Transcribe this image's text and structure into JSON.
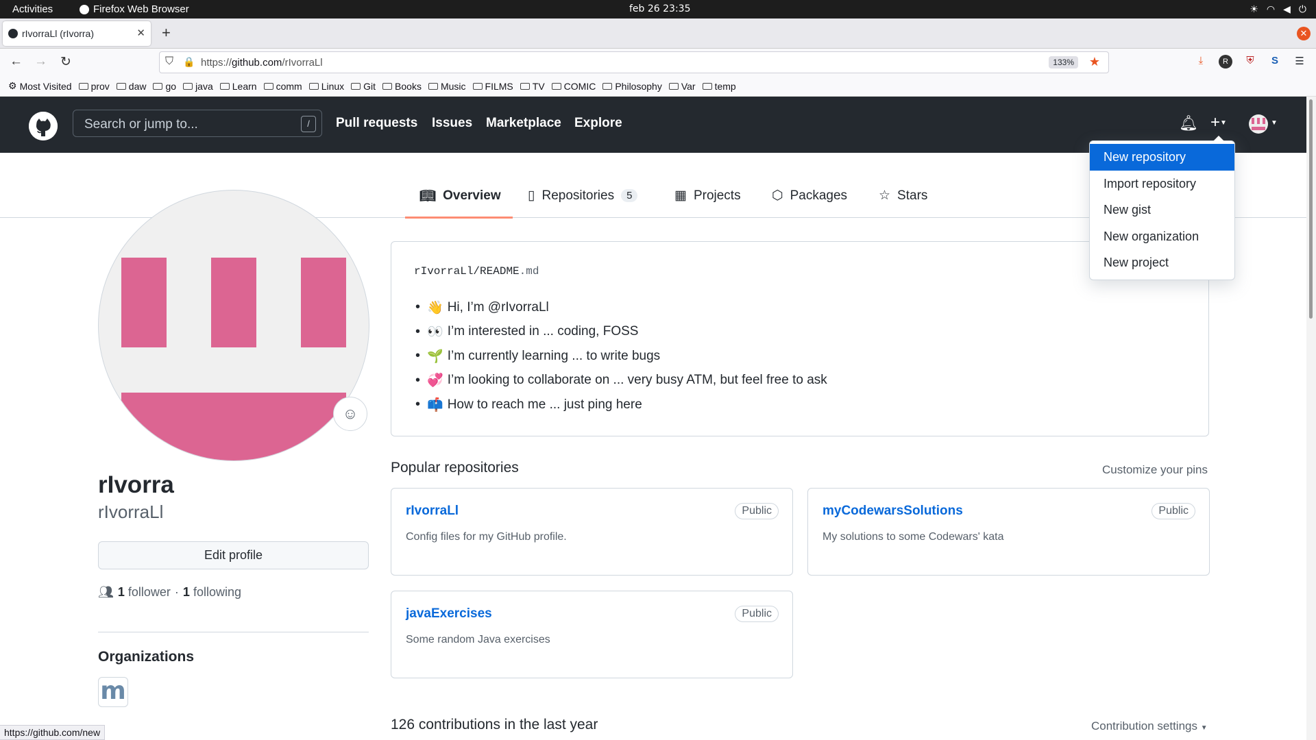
{
  "system": {
    "activities": "Activities",
    "app_name": "Firefox Web Browser",
    "clock": "feb 26  23:35"
  },
  "browser": {
    "tab_title": "rIvorraLl (rIvorra)",
    "url_prefix": "https://",
    "url_domain": "github.com",
    "url_path": "/rIvorraLl",
    "zoom": "133%",
    "status_url": "https://github.com/new"
  },
  "bookmarks": [
    "Most Visited",
    "prov",
    "daw",
    "go",
    "java",
    "Learn",
    "comm",
    "Linux",
    "Git",
    "Books",
    "Music",
    "FILMS",
    "TV",
    "COMIC",
    "Philosophy",
    "Var",
    "temp"
  ],
  "github": {
    "search_placeholder": "Search or jump to...",
    "search_key": "/",
    "nav": [
      "Pull requests",
      "Issues",
      "Marketplace",
      "Explore"
    ]
  },
  "dropdown": [
    "New repository",
    "Import repository",
    "New gist",
    "New organization",
    "New project"
  ],
  "tabs": {
    "overview": "Overview",
    "repositories": "Repositories",
    "repo_count": "5",
    "projects": "Projects",
    "packages": "Packages",
    "stars": "Stars"
  },
  "profile": {
    "name": "rIvorra",
    "login": "rIvorraLl",
    "edit": "Edit profile",
    "followers": "1",
    "followers_label": "follower",
    "sep": "·",
    "following": "1",
    "following_label": "following",
    "orgs_heading": "Organizations",
    "org_letter": "m"
  },
  "readme": {
    "owner": "rIvorraLl",
    "slash": "/",
    "file": "README",
    "ext": ".md",
    "items": [
      {
        "emoji": "👋",
        "text": "Hi, I’m @rIvorraLl"
      },
      {
        "emoji": "👀",
        "text": "I’m interested in ... coding, FOSS"
      },
      {
        "emoji": "🌱",
        "text": "I’m currently learning ... to write bugs"
      },
      {
        "emoji": "💞️",
        "text": "I’m looking to collaborate on ... very busy ATM, but feel free to ask"
      },
      {
        "emoji": "📫",
        "text": "How to reach me ... just ping here"
      }
    ]
  },
  "popular": {
    "heading": "Popular repositories",
    "customize": "Customize your pins",
    "repos": [
      {
        "name": "rIvorraLl",
        "vis": "Public",
        "desc": "Config files for my GitHub profile."
      },
      {
        "name": "myCodewarsSolutions",
        "vis": "Public",
        "desc": "My solutions to some Codewars' kata"
      },
      {
        "name": "javaExercises",
        "vis": "Public",
        "desc": "Some random Java exercises"
      }
    ]
  },
  "contributions": {
    "heading": "126 contributions in the last year",
    "settings": "Contribution settings"
  },
  "colors": {
    "accent": "#0969da",
    "header": "#24292f",
    "avatar_pink": "#dc6592",
    "tab_underline": "#fd8c73"
  }
}
